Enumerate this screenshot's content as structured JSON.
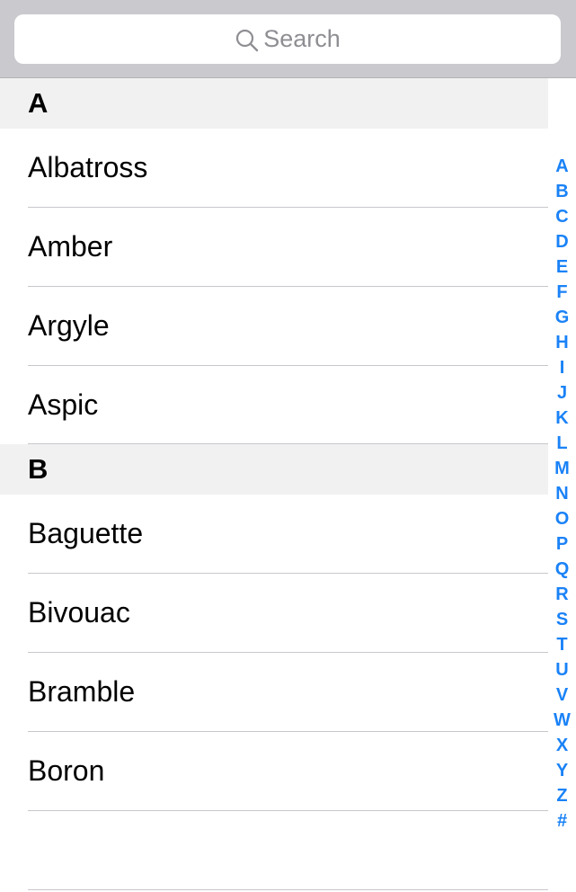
{
  "search": {
    "placeholder": "Search",
    "icon": "search-icon"
  },
  "sections": [
    {
      "title": "A",
      "items": [
        "Albatross",
        "Amber",
        "Argyle",
        "Aspic"
      ]
    },
    {
      "title": "B",
      "items": [
        "Baguette",
        "Bivouac",
        "Bramble",
        "Boron",
        ""
      ]
    }
  ],
  "index": [
    "A",
    "B",
    "C",
    "D",
    "E",
    "F",
    "G",
    "H",
    "I",
    "J",
    "K",
    "L",
    "M",
    "N",
    "O",
    "P",
    "Q",
    "R",
    "S",
    "T",
    "U",
    "V",
    "W",
    "X",
    "Y",
    "Z",
    "#"
  ],
  "colors": {
    "accent": "#1a82f7",
    "search_bar_bg": "#c9c9ce",
    "section_header_bg": "#f1f1f1",
    "separator": "#c8c7cc",
    "placeholder": "#8e8e93"
  }
}
